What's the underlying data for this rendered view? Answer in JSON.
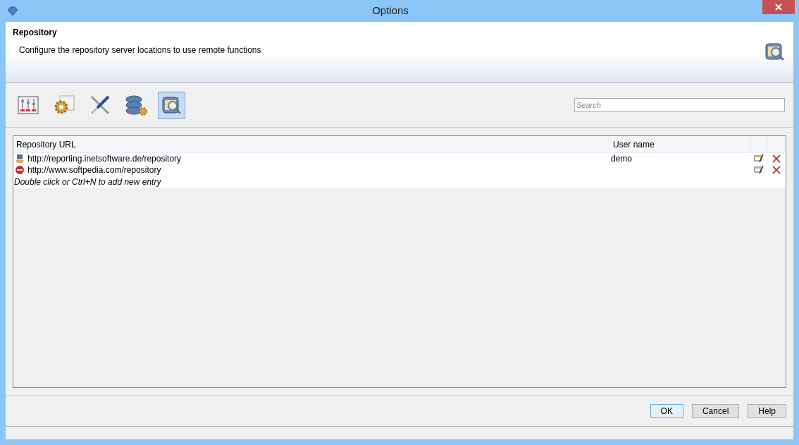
{
  "window": {
    "title": "Options"
  },
  "header": {
    "title": "Repository",
    "description": "Configure the repository server locations to use remote functions"
  },
  "toolbar": [
    {
      "kind": "sliders",
      "selected": false
    },
    {
      "kind": "gear",
      "selected": false
    },
    {
      "kind": "tools",
      "selected": false
    },
    {
      "kind": "database",
      "selected": false
    },
    {
      "kind": "repository",
      "selected": true
    }
  ],
  "search": {
    "placeholder": "Search"
  },
  "table": {
    "columns": [
      "Repository URL",
      "User name"
    ],
    "rows": [
      {
        "kind": "server",
        "url": "http://reporting.inetsoftware.de/repository",
        "user": "demo"
      },
      {
        "kind": "blocked",
        "url": "http://www.softpedia.com/repository"
      }
    ],
    "hint": "Double click or Ctrl+N to add new entry"
  },
  "buttons": [
    {
      "label": "OK",
      "selected": true
    },
    {
      "label": "Cancel",
      "selected": false
    },
    {
      "label": "Help",
      "selected": false
    }
  ]
}
